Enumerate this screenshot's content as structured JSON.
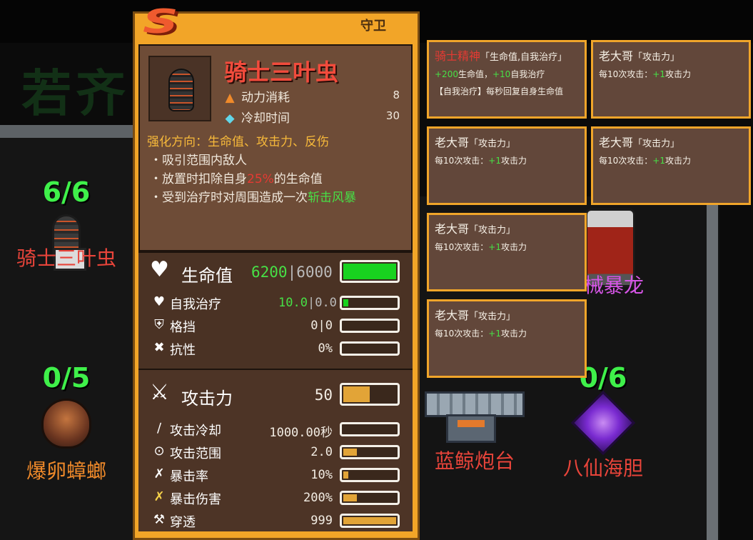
{
  "card": {
    "tier": "S",
    "role": "守卫",
    "title": "骑士三叶虫",
    "power_label": "动力消耗",
    "power_value": "8",
    "cooldown_label": "冷却时间",
    "cooldown_value": "30",
    "direction": "强化方向：生命值、攻击力、反伤",
    "bullets": [
      {
        "prefix": "・吸引范围内敌人",
        "highlight": "",
        "suffix": ""
      },
      {
        "prefix": "・放置时扣除自身",
        "highlight": "25%",
        "suffix": "的生命值"
      },
      {
        "prefix": "・受到治疗时对周围造成一次",
        "highlight": "斩击风暴",
        "suffix": ""
      }
    ],
    "hp": {
      "label": "生命值",
      "current": "6200",
      "sep": "|",
      "max": "6000",
      "fill": 1.0
    },
    "heal": {
      "label": "自我治疗",
      "current": "10.0",
      "sep": "|",
      "base": "0.0",
      "fill": 0.1
    },
    "block": {
      "label": "格挡",
      "value": "0|0",
      "fill": 0
    },
    "resist": {
      "label": "抗性",
      "value": "0%",
      "fill": 0
    },
    "attack": {
      "label": "攻击力",
      "value": "50",
      "fill": 0.5
    },
    "attack_cd": {
      "label": "攻击冷却",
      "value": "1000.00秒",
      "fill": 0
    },
    "attack_range": {
      "label": "攻击范围",
      "value": "2.0",
      "fill": 0.25
    },
    "crit_rate": {
      "label": "暴击率",
      "value": "10%",
      "fill": 0.1
    },
    "crit_dmg": {
      "label": "暴击伤害",
      "value": "200%",
      "fill": 0.25
    },
    "pierce": {
      "label": "穿透",
      "value": "999",
      "fill": 1.0
    }
  },
  "buffs": [
    {
      "name": "骑士精神",
      "tag": "「生命值,自我治疗」",
      "desc_a": "+200",
      "desc_b": "生命值，",
      "desc_c": "+10",
      "desc_d": "自我治疗",
      "extra": "【自我治疗】每秒回复自身生命值"
    },
    {
      "name": "老大哥",
      "tag": "「攻击力」",
      "desc_a": "每10次攻击：",
      "desc_b": "+1",
      "desc_c": "攻击力"
    },
    {
      "name": "老大哥",
      "tag": "「攻击力」",
      "desc_a": "每10次攻击：",
      "desc_b": "+1",
      "desc_c": "攻击力"
    },
    {
      "name": "老大哥",
      "tag": "「攻击力」",
      "desc_a": "每10次攻击：",
      "desc_b": "+1",
      "desc_c": "攻击力"
    },
    {
      "name": "老大哥",
      "tag": "「攻击力」",
      "desc_a": "每10次攻击：",
      "desc_b": "+1",
      "desc_c": "攻击力"
    },
    {
      "name": "老大哥",
      "tag": "「攻击力」",
      "desc_a": "每10次攻击：",
      "desc_b": "+1",
      "desc_c": "攻击力"
    }
  ],
  "units": {
    "u1": {
      "count": "6/6",
      "name": "骑士三叶虫",
      "name_color": "#e8443a"
    },
    "u2": {
      "count": "0/5",
      "name": "爆卵蟑螂",
      "name_color": "#f08a2a"
    },
    "u3": {
      "name": "蓝鲸炮台",
      "name_color": "#e8443a"
    },
    "u4": {
      "count": "0/6",
      "name": "八仙海胆",
      "name_color": "#e8443a"
    },
    "u5": {
      "name": "械暴龙",
      "name_color": "#d655e6"
    }
  },
  "colors": {
    "accent": "#f2a528",
    "hp_green": "#18d21f",
    "bar_gold": "#e2a437",
    "value_green": "#47e046"
  }
}
